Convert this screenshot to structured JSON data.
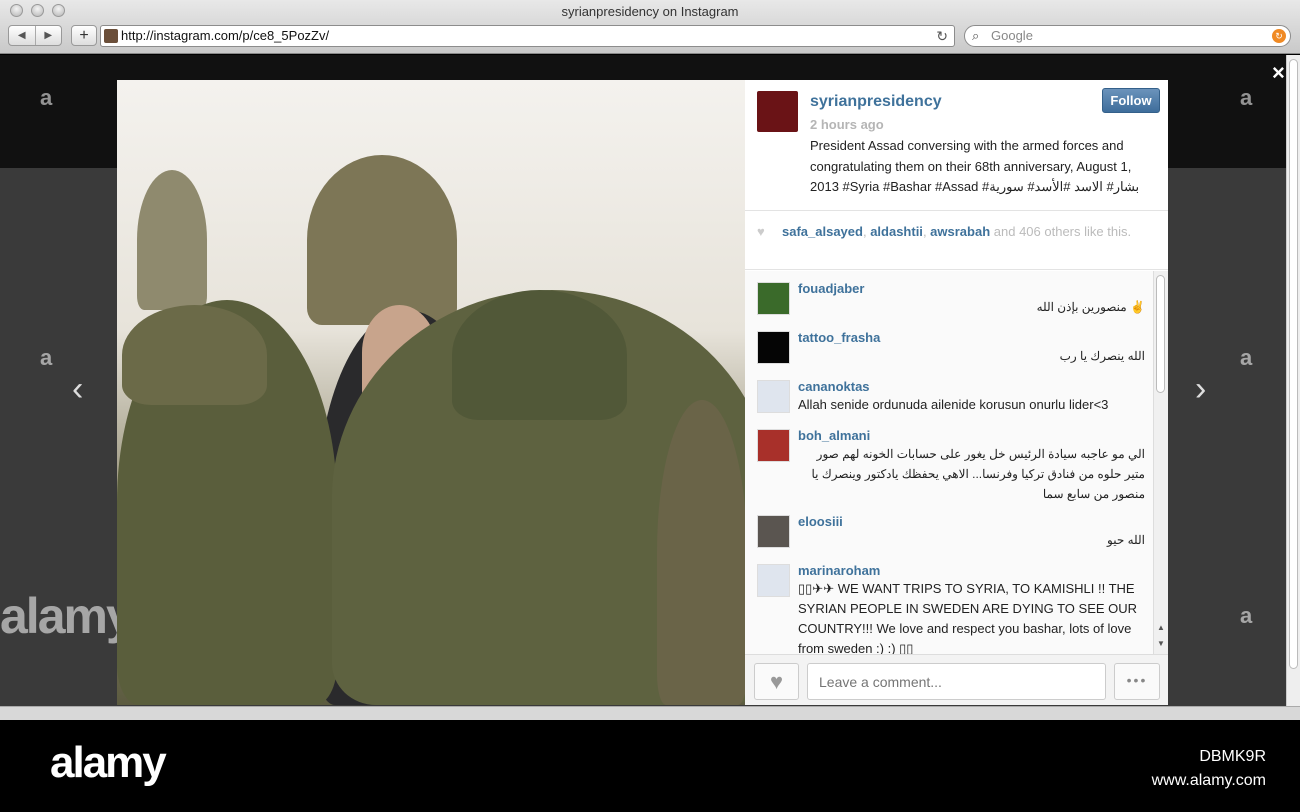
{
  "browser": {
    "title": "syrianpresidency on Instagram",
    "url": "http://instagram.com/p/ce8_5PozZv/",
    "search_placeholder": "Google",
    "back": "◀",
    "forward": "▶",
    "add": "+",
    "reload": "↻",
    "search_icon": "🔍",
    "go": "↻"
  },
  "modal": {
    "close": "×",
    "prev": "‹",
    "next": "›"
  },
  "post": {
    "username": "syrianpresidency",
    "time": "2 hours ago",
    "caption": "President Assad conversing with the armed forces and congratulating them on their 68th anniversary, August 1, 2013 #Syria #Bashar #Assad #بشار# الاسد #الأسد# سورية",
    "follow_label": "Follow",
    "avatar_color": "#6a1316"
  },
  "likes": {
    "users": [
      "safa_alsayed",
      "aldashtii",
      "awsrabah"
    ],
    "sep1": ", ",
    "sep2": ", ",
    "rest": " and 406 others like this."
  },
  "comments": [
    {
      "user": "fouadjaber",
      "text": "✌ منصورين بإذن الله",
      "rtl": true,
      "avatar": "#3a6a2a"
    },
    {
      "user": "tattoo_frasha",
      "text": "الله ينصرك يا رب",
      "rtl": true,
      "avatar": "#050505"
    },
    {
      "user": "cananoktas",
      "text": "Allah senide ordunuda ailenide korusun onurlu lider<3",
      "rtl": false,
      "avatar": "#dfe5ee"
    },
    {
      "user": "boh_almani",
      "text": "الي مو عاجبه سيادة الرئيس خل يغور على حسابات الخونه لهم صور متير حلوه من فنادق تركيا وفرنسا... الاهي يحفظك يادكتور وينصرك يا منصور من سابع سما",
      "rtl": true,
      "avatar": "#a8302a"
    },
    {
      "user": "eloosiii",
      "text": "الله حيو",
      "rtl": true,
      "avatar": "#5a5550"
    },
    {
      "user": "marinaroham",
      "text": "▯▯✈✈ WE WANT TRIPS TO SYRIA, TO KAMISHLI !! THE SYRIAN PEOPLE IN SWEDEN ARE DYING TO SEE OUR COUNTRY!!! We love and respect you bashar, lots of love from sweden :) :) ▯▯",
      "rtl": false,
      "avatar": "#dfe5ee"
    }
  ],
  "comment_box": {
    "placeholder": "Leave a comment...",
    "like_icon": "♥",
    "more_label": "•••"
  },
  "watermark": {
    "brand": "alamy",
    "image_id": "DBMK9R",
    "site": "www.alamy.com",
    "mark": "a"
  }
}
